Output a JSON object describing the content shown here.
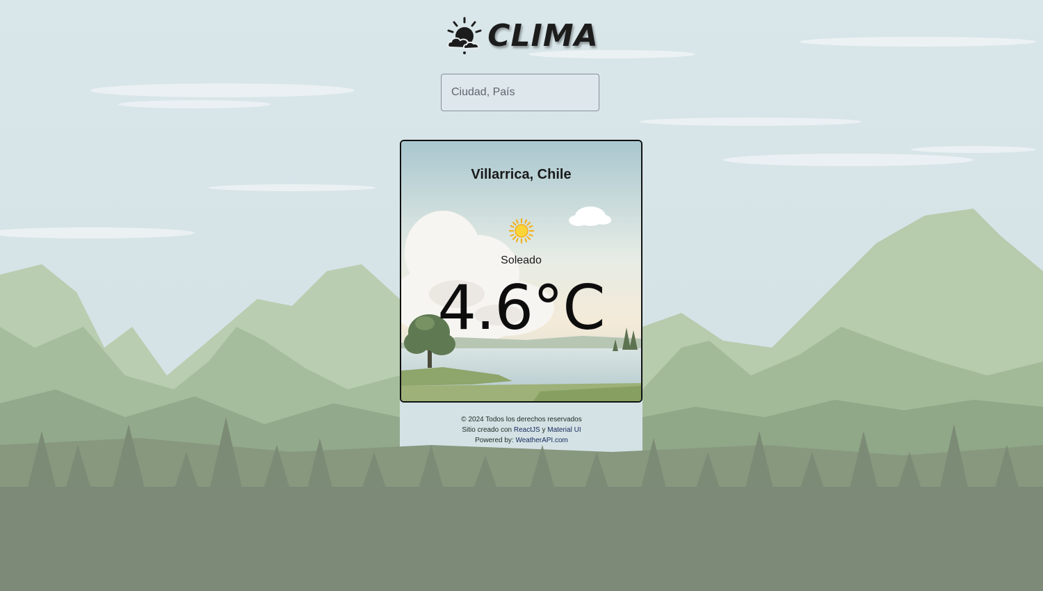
{
  "header": {
    "logo_text": "CLIMA",
    "logo_icon": "sun-cloud-icon"
  },
  "search": {
    "placeholder": "Ciudad, País",
    "value": ""
  },
  "weather": {
    "location": "Villarrica, Chile",
    "condition": "Soleado",
    "condition_icon": "sun-icon",
    "temperature": "4.6°C"
  },
  "footer": {
    "copyright": "© 2024 Todos los derechos reservados",
    "created_prefix": "Sitio creado con ",
    "react_link": "ReactJS",
    "created_joiner": " y ",
    "mui_link": "Material UI",
    "powered_prefix": "Powered by: ",
    "api_link": "WeatherAPI.com"
  },
  "colors": {
    "sky": "#d6e3e8",
    "mountain": "#a6c09a",
    "forest": "#7f8c7b",
    "text": "#1a1a1a"
  }
}
